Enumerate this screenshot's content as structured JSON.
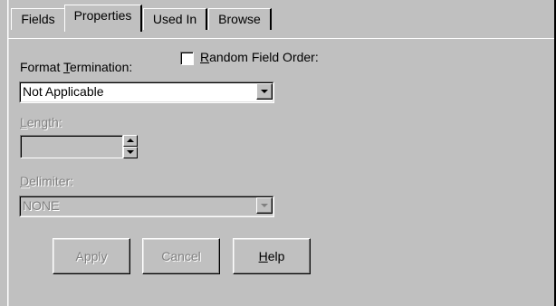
{
  "tabs": [
    {
      "label": "Fields",
      "active": false
    },
    {
      "label": "Properties",
      "active": true
    },
    {
      "label": "Used In",
      "active": false
    },
    {
      "label": "Browse",
      "active": false
    }
  ],
  "format_termination": {
    "label_pre": "Format ",
    "label_u": "T",
    "label_post": "ermination:",
    "value": "Not Applicable"
  },
  "random_field_order": {
    "label_u": "R",
    "label_post": "andom Field Order:",
    "checked": false
  },
  "length": {
    "label_u": "L",
    "label_post": "ength:",
    "value": "",
    "enabled": false
  },
  "delimiter": {
    "label_u": "D",
    "label_post": "elimiter:",
    "value": "NONE",
    "enabled": false
  },
  "buttons": {
    "apply": "Apply",
    "cancel": "Cancel",
    "help_u": "H",
    "help_post": "elp"
  },
  "colors": {
    "face": "#c0c0c0",
    "disabled_text": "#808080"
  }
}
